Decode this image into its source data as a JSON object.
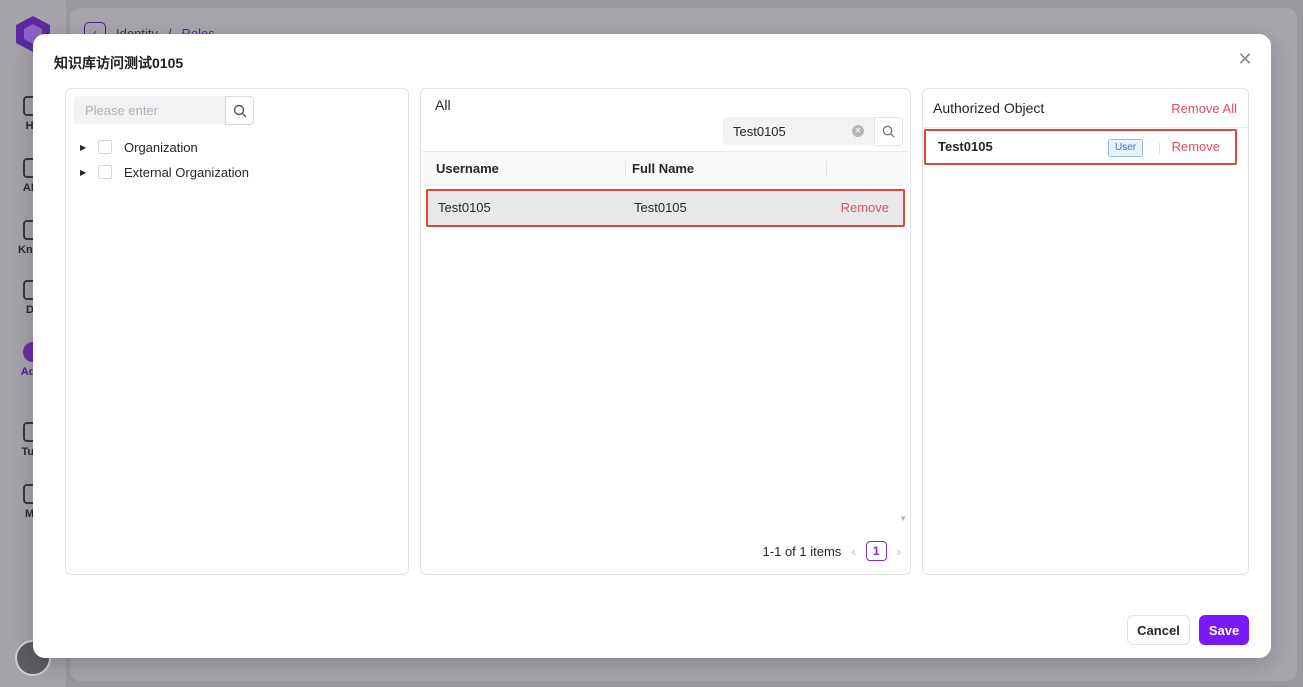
{
  "background": {
    "breadcrumb": [
      "Identity",
      "/",
      "Roles"
    ],
    "nav_items": [
      "Ho",
      "AI a",
      "Know",
      "Da",
      "Adm",
      "Tuto",
      "Mo"
    ]
  },
  "modal": {
    "title": "知识库访问测试0105",
    "close_icon": "close-icon"
  },
  "left_panel": {
    "search_placeholder": "Please enter",
    "tree": [
      {
        "label": "Organization"
      },
      {
        "label": "External Organization"
      }
    ]
  },
  "middle_panel": {
    "title": "All",
    "search_value": "Test0105",
    "columns": [
      "Username",
      "Full Name"
    ],
    "rows": [
      {
        "username": "Test0105",
        "full_name": "Test0105",
        "action": "Remove"
      }
    ],
    "pagination": {
      "summary": "1-1 of 1 items",
      "current_page": "1"
    }
  },
  "right_panel": {
    "title": "Authorized Object",
    "remove_all": "Remove All",
    "items": [
      {
        "name": "Test0105",
        "tag": "User",
        "action": "Remove"
      }
    ]
  },
  "footer": {
    "cancel": "Cancel",
    "save": "Save"
  },
  "colors": {
    "accent": "#7b19f5",
    "danger": "#e34d5f",
    "highlight_border": "#e0463a"
  }
}
